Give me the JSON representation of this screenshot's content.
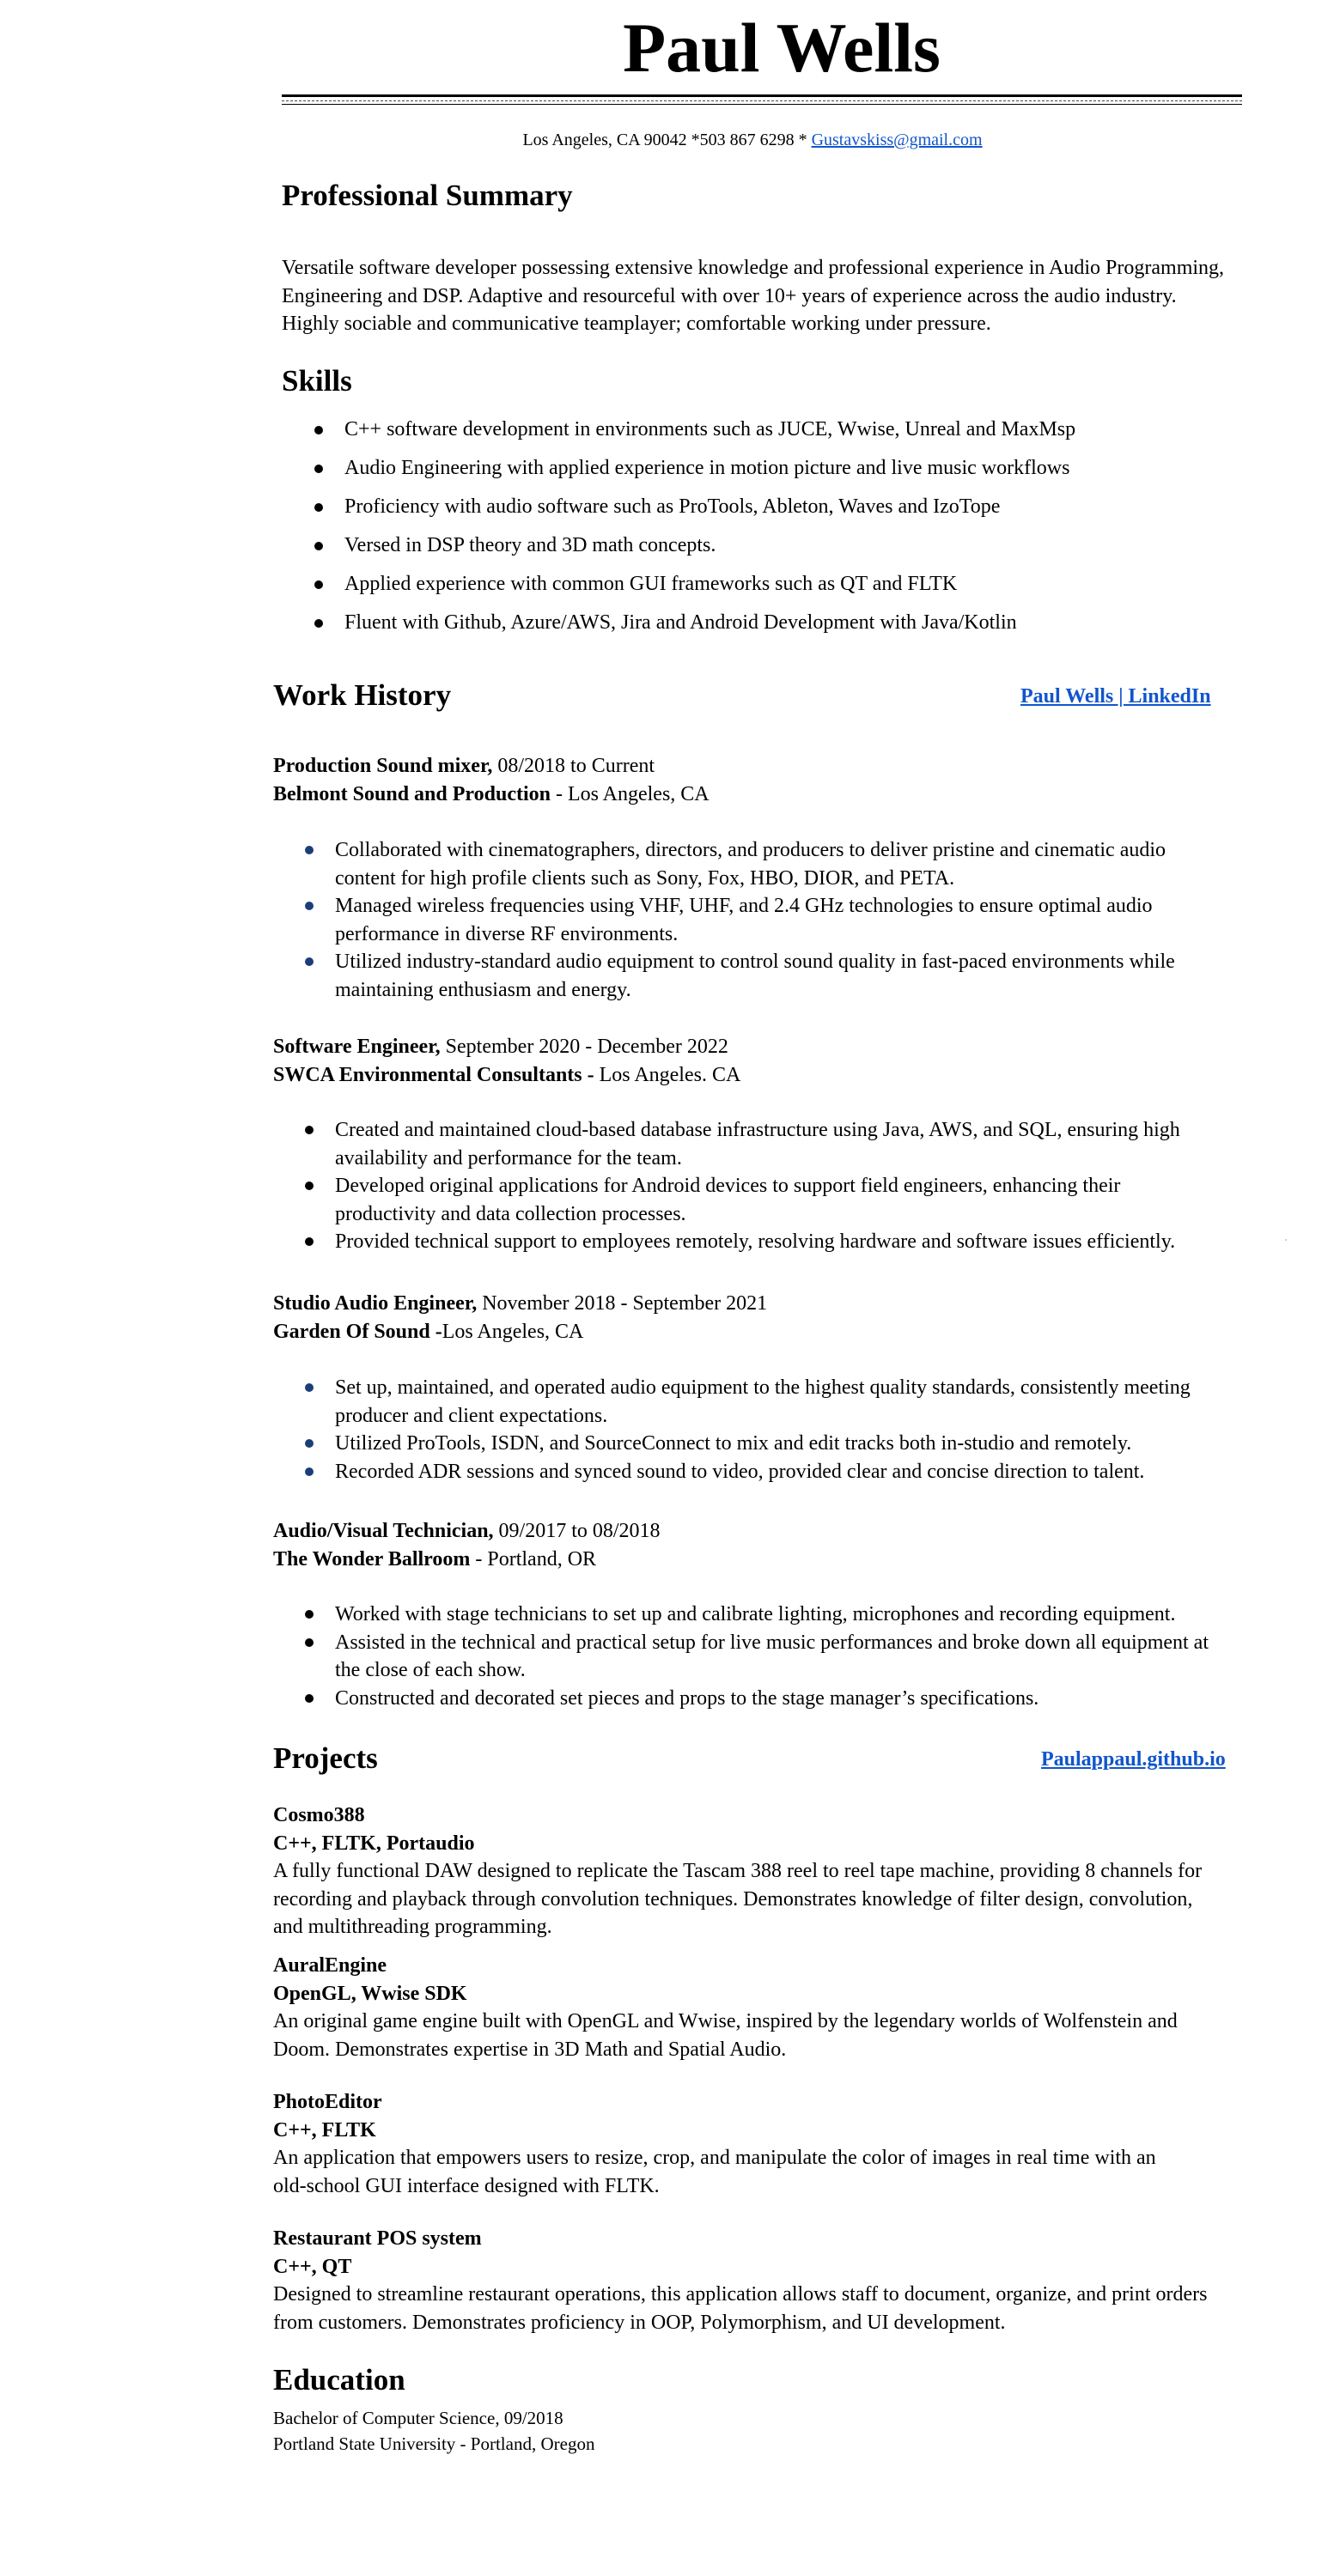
{
  "header": {
    "name": "Paul Wells",
    "contact_text": "Los Angeles, CA 90042 *503 867 6298 * ",
    "email": "Gustavskiss@gmail.com"
  },
  "summary": {
    "heading": "Professional Summary",
    "lines": [
      "Versatile software developer possessing extensive knowledge and professional experience in Audio Programming,",
      "Engineering and DSP. Adaptive and resourceful with over 10+ years of experience across the audio industry.",
      "Highly sociable and communicative teamplayer; comfortable working under pressure."
    ]
  },
  "skills": {
    "heading": "Skills",
    "items": [
      "C++ software development in environments such as JUCE, Wwise, Unreal and MaxMsp",
      "Audio Engineering with applied experience in motion picture and live music workflows",
      "Proficiency with audio software such as ProTools, Ableton, Waves and IzoTope",
      "Versed in DSP theory and 3D math concepts.",
      "Applied experience with common GUI frameworks such as QT and FLTK",
      "Fluent with Github, Azure/AWS, Jira and Android Development with Java/Kotlin"
    ]
  },
  "work": {
    "heading": "Work History",
    "link": "Paul Wells | LinkedIn",
    "jobs": [
      {
        "title": "Production Sound mixer,",
        "dates": " 08/2018 to Current",
        "company": "Belmont Sound and Production",
        "location": " - Los Angeles, CA",
        "bullets": [
          [
            "Collaborated with cinematographers, directors, and producers to deliver pristine and cinematic audio",
            "content for high profile clients such as Sony, Fox, HBO, DIOR, and PETA."
          ],
          [
            "Managed wireless frequencies using VHF, UHF, and 2.4 GHz technologies to ensure optimal audio",
            "performance in diverse RF environments."
          ],
          [
            "Utilized industry-standard audio equipment to control sound quality in fast-paced environments while",
            "maintaining enthusiasm and energy."
          ]
        ]
      },
      {
        "title": "Software Engineer,",
        "dates": " September 2020 - December 2022",
        "company": "SWCA Environmental Consultants -",
        "location": " Los Angeles. CA",
        "bullets": [
          [
            "Created and maintained cloud-based database infrastructure using Java, AWS, and SQL, ensuring high",
            "availability and performance for the team."
          ],
          [
            "Developed original applications for Android devices to support field engineers, enhancing their",
            "productivity and data collection processes."
          ],
          [
            "Provided technical support to employees remotely, resolving hardware and software issues efficiently."
          ]
        ]
      },
      {
        "title": "Studio Audio Engineer,",
        "dates": " November 2018 - September 2021",
        "company": "Garden Of Sound -",
        "location": "Los Angeles, CA",
        "bullets": [
          [
            "Set up, maintained, and operated audio equipment to the highest quality standards, consistently meeting",
            "producer and client expectations."
          ],
          [
            "Utilized ProTools, ISDN, and SourceConnect to mix and edit tracks both in-studio and remotely."
          ],
          [
            " Recorded ADR sessions and synced sound to video, provided clear and concise direction to talent."
          ]
        ]
      },
      {
        "title": "Audio/Visual Technician,",
        "dates": " 09/2017 to 08/2018",
        "company": "The Wonder Ballroom",
        "location": " - Portland, OR",
        "bullets": [
          [
            "Worked with stage technicians to set up and calibrate lighting, microphones and recording equipment."
          ],
          [
            "Assisted in the technical and practical setup for live music performances and broke down all equipment at",
            "the close of each show."
          ],
          [
            "Constructed and decorated set pieces and props to the stage manager’s specifications."
          ]
        ]
      }
    ]
  },
  "projects": {
    "heading": "Projects",
    "link": "Paulappaul.github.io",
    "items": [
      {
        "name": "Cosmo388",
        "tech": "C++, FLTK, Portaudio",
        "lines": [
          "A fully functional DAW designed to replicate the Tascam 388 reel to reel tape machine, providing 8 channels for",
          "recording and playback through convolution techniques. Demonstrates knowledge of filter design, convolution,",
          "and multithreading programming."
        ]
      },
      {
        "name": "AuralEngine",
        "tech": "OpenGL, Wwise SDK",
        "lines": [
          "An original game engine built with OpenGL and Wwise, inspired by the legendary worlds of Wolfenstein and",
          "Doom. Demonstrates expertise in 3D Math and Spatial Audio."
        ]
      },
      {
        "name": "PhotoEditor",
        "tech": "C++, FLTK",
        "lines": [
          "An application that empowers users to resize, crop, and manipulate the color of images in real time with an",
          "old-school GUI interface designed with FLTK."
        ]
      },
      {
        "name": "Restaurant POS system",
        "tech": "C++, QT",
        "lines": [
          "Designed to streamline restaurant operations, this application allows staff to document, organize, and print orders",
          "from customers. Demonstrates proficiency in OOP, Polymorphism, and UI development."
        ]
      }
    ]
  },
  "education": {
    "heading": "Education",
    "degree": "Bachelor of Computer Science, 09/2018",
    "school": "Portland State University - Portland, Oregon"
  }
}
